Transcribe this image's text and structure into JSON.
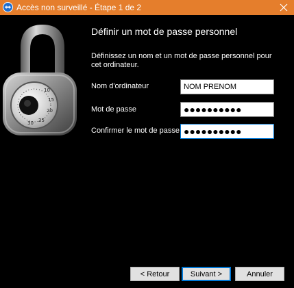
{
  "window": {
    "title": "Accès non surveillé - Étape 1 de 2",
    "close_icon": "close-icon",
    "title_bar_color": "#e57e2c"
  },
  "illustration": {
    "icon": "combination-padlock"
  },
  "content": {
    "heading": "Définir un mot de passe personnel",
    "description": "Définissez un nom et un mot de passe personnel pour cet ordinateur."
  },
  "form": {
    "computer_name": {
      "label": "Nom d'ordinateur",
      "value": "NOM PRENOM"
    },
    "password": {
      "label": "Mot de passe",
      "value": "●●●●●●●●●●"
    },
    "confirm_password": {
      "label": "Confirmer le mot de passe",
      "value": "●●●●●●●●●●"
    }
  },
  "buttons": {
    "back": "< Retour",
    "next": "Suivant >",
    "cancel": "Annuler"
  }
}
